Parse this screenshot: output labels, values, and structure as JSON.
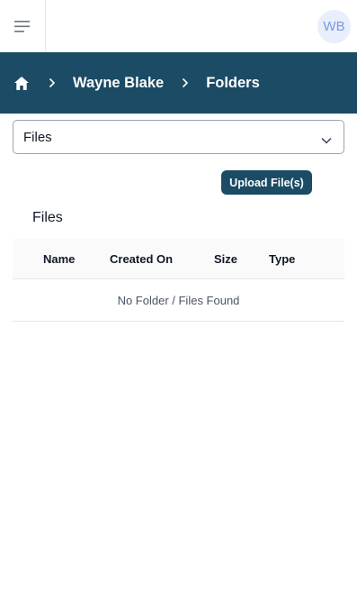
{
  "header": {
    "avatar_initials": "WB"
  },
  "breadcrumb": {
    "items": [
      "Wayne Blake",
      "Folders"
    ]
  },
  "filter": {
    "selected": "Files"
  },
  "actions": {
    "upload_label": "Upload File(s)"
  },
  "section": {
    "title": "Files"
  },
  "table": {
    "columns": [
      "Name",
      "Created On",
      "Size",
      "Type"
    ],
    "empty_message": "No Folder / Files Found"
  },
  "colors": {
    "brand": "#1b4b65",
    "avatar_bg": "#e8eefb",
    "avatar_text": "#7a9ae0"
  }
}
